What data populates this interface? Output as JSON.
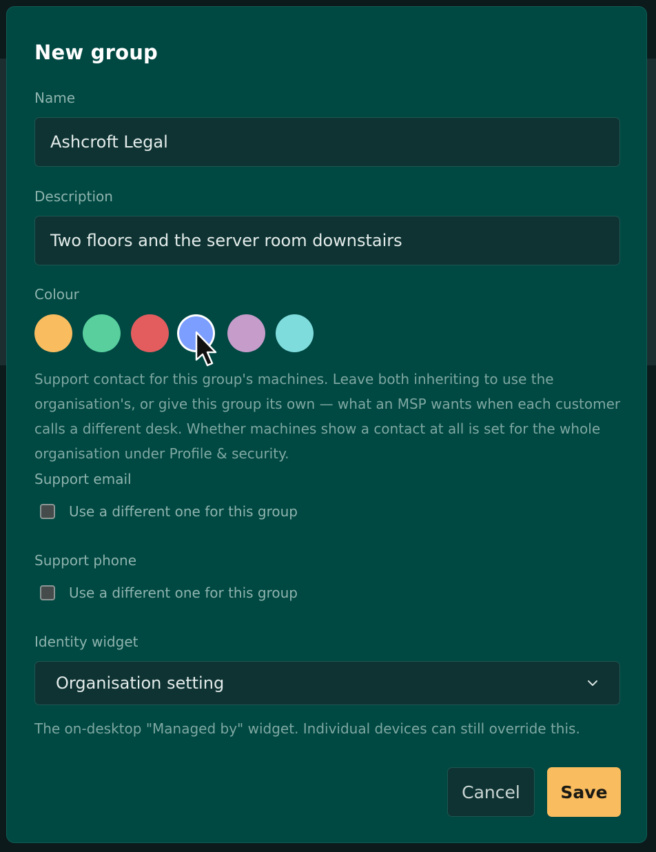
{
  "dialog": {
    "title": "New group",
    "name_label": "Name",
    "name_value": "Ashcroft Legal",
    "description_label": "Description",
    "description_value": "Two floors and the server room downstairs",
    "colour_label": "Colour",
    "colours": [
      {
        "name": "orange",
        "hex": "#f9bc5f",
        "selected": false
      },
      {
        "name": "green",
        "hex": "#58cf9d",
        "selected": false
      },
      {
        "name": "red",
        "hex": "#e35d5f",
        "selected": false
      },
      {
        "name": "blue",
        "hex": "#7b9eff",
        "selected": true
      },
      {
        "name": "purple",
        "hex": "#c69cca",
        "selected": false
      },
      {
        "name": "cyan",
        "hex": "#7fdcdc",
        "selected": false
      }
    ],
    "support_help": "Support contact for this group's machines. Leave both inheriting to use the organisation's, or give this group its own — what an MSP wants when each customer calls a different desk. Whether machines show a contact at all is set for the whole organisation under Profile & security.",
    "support_email_label": "Support email",
    "support_email_checkbox_label": "Use a different one for this group",
    "support_email_checked": false,
    "support_phone_label": "Support phone",
    "support_phone_checkbox_label": "Use a different one for this group",
    "support_phone_checked": false,
    "identity_widget_label": "Identity widget",
    "identity_widget_value": "Organisation setting",
    "identity_widget_help": "The on-desktop \"Managed by\" widget. Individual devices can still override this.",
    "cancel_label": "Cancel",
    "save_label": "Save"
  },
  "colors": {
    "dialog_bg": "#004842",
    "field_bg": "#0f3333",
    "accent": "#f9bc5f"
  }
}
